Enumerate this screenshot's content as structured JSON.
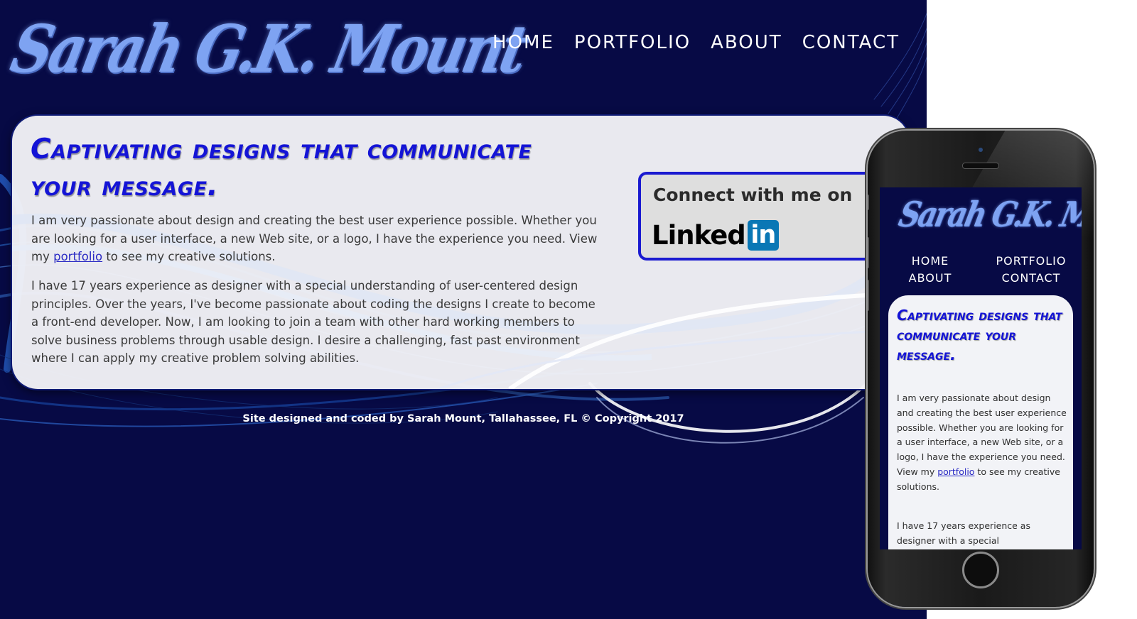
{
  "site": {
    "logo_text": "Sarah G.K. Mount",
    "nav": [
      "HOME",
      "PORTFOLIO",
      "ABOUT",
      "CONTACT"
    ],
    "headline": "Captivating designs that communicate your message.",
    "para1_before_link": "I am very passionate about design and creating the best user experience possible. Whether you are looking for a user interface, a new Web site, or a logo, I have the experience you need. View my ",
    "para1_link": "portfolio",
    "para1_after_link": " to see my creative solutions.",
    "para2": "I have 17 years experience as designer with a special understanding of user-centered design principles. Over the years, I've become passionate about coding the designs I create to become a front-end developer. Now, I am looking to join a team with other hard working members to solve business problems through usable design. I desire a challenging, fast past environment where I can apply my creative problem solving abilities.",
    "linkedin": {
      "title": "Connect with me on",
      "word": "Linked",
      "badge": "in"
    },
    "footer": "Site designed and coded by Sarah Mount, Tallahassee, FL © Copyright 2017"
  },
  "mobile": {
    "logo_text": "Sarah G.K. Mount",
    "nav": [
      "HOME",
      "PORTFOLIO",
      "ABOUT",
      "CONTACT"
    ],
    "headline": "Captivating designs that communicate your message.",
    "para1_before_link": "I am very passionate about design and creating the best user experience possible. Whether you are looking for a user interface, a new Web site, or a logo, I have the experience you need. View my ",
    "para1_link": "portfolio",
    "para1_after_link": " to see my creative solutions.",
    "para2_visible": "I have 17 years experience as designer with a special"
  },
  "colors": {
    "background": "#070a45",
    "headline": "#1414d6",
    "logo": "#7ea3f2",
    "card": "#f2f3f7",
    "linkedin_blue": "#0a77b5"
  }
}
